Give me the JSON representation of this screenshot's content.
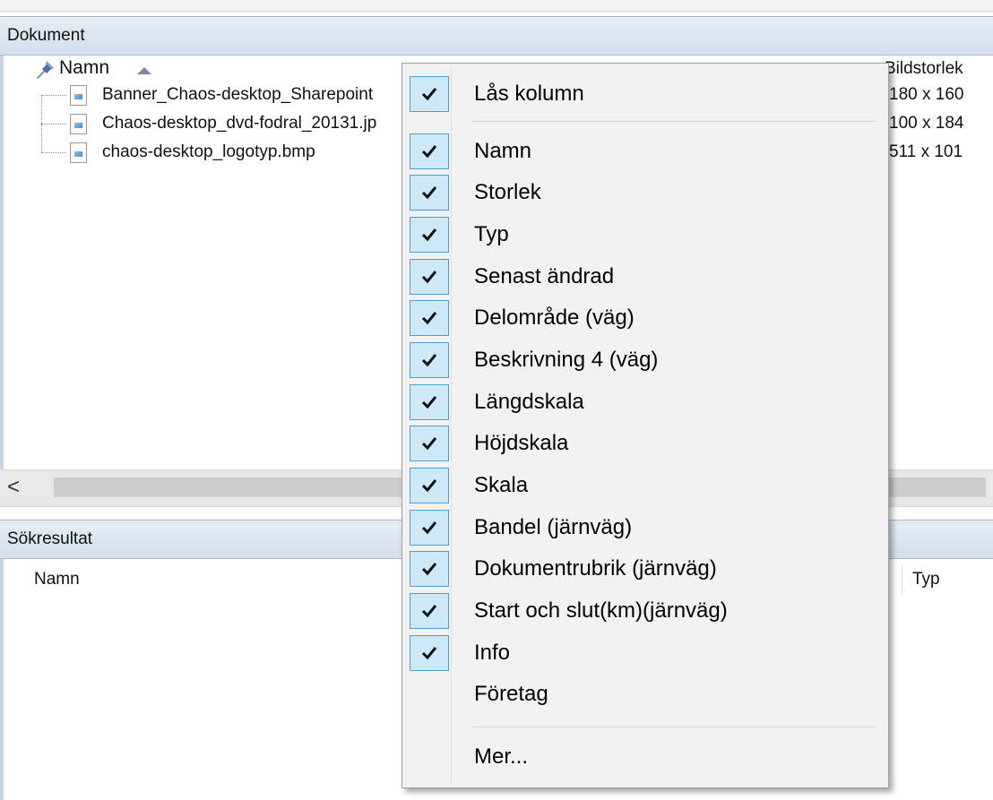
{
  "documents_panel": {
    "title": "Dokument",
    "column_name": "Namn",
    "column_imagesize": "Bildstorlek",
    "files": [
      {
        "name": "Banner_Chaos-desktop_Sharepoint",
        "size": "180 x 160"
      },
      {
        "name": "Chaos-desktop_dvd-fodral_20131.jp",
        "size": "100 x 184"
      },
      {
        "name": "chaos-desktop_logotyp.bmp",
        "size": "511 x 101"
      }
    ],
    "scroll_left_glyph": "<"
  },
  "search_panel": {
    "title": "Sökresultat",
    "column_name": "Namn",
    "column_type": "Typ"
  },
  "context_menu": {
    "lock_column": {
      "label": "Lås kolumn",
      "checked": true
    },
    "items": [
      {
        "label": "Namn",
        "checked": true
      },
      {
        "label": "Storlek",
        "checked": true
      },
      {
        "label": "Typ",
        "checked": true
      },
      {
        "label": "Senast ändrad",
        "checked": true
      },
      {
        "label": "Delområde (väg)",
        "checked": true
      },
      {
        "label": "Beskrivning 4 (väg)",
        "checked": true
      },
      {
        "label": "Längdskala",
        "checked": true
      },
      {
        "label": "Höjdskala",
        "checked": true
      },
      {
        "label": "Skala",
        "checked": true
      },
      {
        "label": "Bandel (järnväg)",
        "checked": true
      },
      {
        "label": "Dokumentrubrik (järnväg)",
        "checked": true
      },
      {
        "label": "Start och slut(km)(järnväg)",
        "checked": true
      },
      {
        "label": "Info",
        "checked": true
      },
      {
        "label": "Företag",
        "checked": false
      }
    ],
    "more": {
      "label": "Mer..."
    }
  },
  "colors": {
    "check_bg": "#cde8f6",
    "check_border": "#4e9ed2",
    "panel_title_bg": "#d8e3ef"
  }
}
